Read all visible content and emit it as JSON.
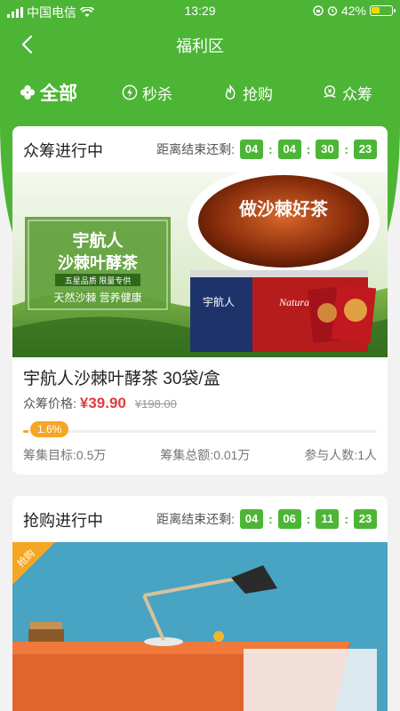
{
  "status_bar": {
    "carrier": "中国电信",
    "time": "13:29",
    "battery_pct": "42%",
    "battery_level": 0.42
  },
  "nav": {
    "title": "福利区"
  },
  "tabs": [
    {
      "label": "全部",
      "icon": "clover-icon",
      "active": true
    },
    {
      "label": "秒杀",
      "icon": "lightning-icon",
      "active": false
    },
    {
      "label": "抢购",
      "icon": "flame-icon",
      "active": false
    },
    {
      "label": "众筹",
      "icon": "coin-hand-icon",
      "active": false
    }
  ],
  "cards": [
    {
      "title": "众筹进行中",
      "countdown_label": "距离结束还剩:",
      "countdown": [
        "04",
        "04",
        "30",
        "23"
      ],
      "banner": {
        "headline": "宇航人",
        "headline2": "沙棘叶酵茶",
        "sub": "五星品质  限量专供",
        "slogan": "天然沙棘  营养健康",
        "cup_text": "做沙棘好茶",
        "box_brand": "宇航人",
        "box_brand2": "Natural"
      },
      "product_name": "宇航人沙棘叶酵茶 30袋/盒",
      "price_label": "众筹价格:",
      "price": "¥39.90",
      "old_price": "¥198.00",
      "progress_text": "1.6%",
      "progress": 0.016,
      "stats": {
        "target": "筹集目标:0.5万",
        "total": "筹集总额:0.01万",
        "participants": "参与人数:1人"
      }
    },
    {
      "title": "抢购进行中",
      "countdown_label": "距离结束还剩:",
      "countdown": [
        "04",
        "06",
        "11",
        "23"
      ],
      "corner_tag": "抢购"
    }
  ],
  "colors": {
    "primary": "#4cb535",
    "accent_orange": "#f5a623",
    "price_red": "#e23b3b"
  }
}
